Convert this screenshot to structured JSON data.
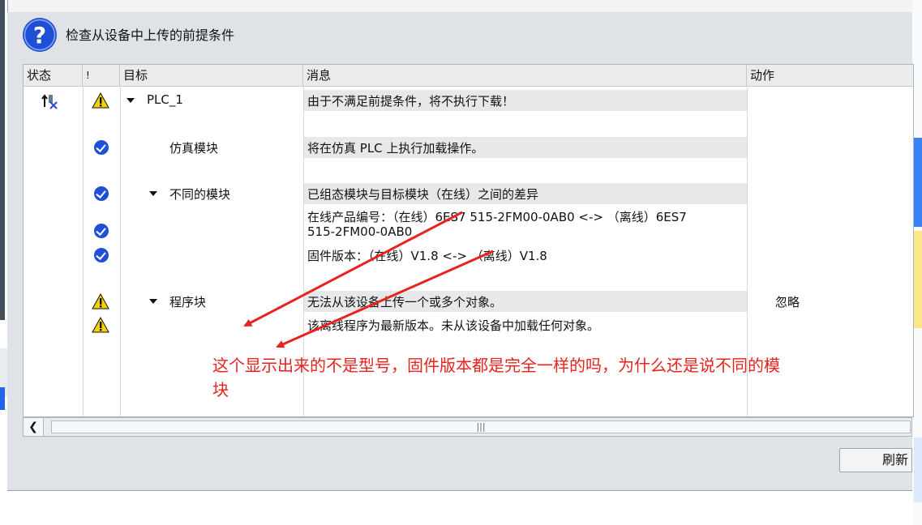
{
  "dialog": {
    "title": "检查从设备中上传的前提条件",
    "refresh_label": "刷新"
  },
  "table": {
    "headers": [
      "状态",
      "!",
      "目标",
      "消息",
      "动作"
    ],
    "rows": [
      {
        "status_icon": "upload-error-icon",
        "flag": "warning",
        "target": "PLC_1",
        "expanded": true,
        "message": "由于不满足前提条件，将不执行下载！",
        "action": ""
      },
      {
        "flag": "ok",
        "target": "仿真模块",
        "message": "将在仿真 PLC 上执行加载操作。",
        "action": ""
      },
      {
        "flag": "ok",
        "target": "不同的模块",
        "expanded": true,
        "message": "已组态模块与目标模块（在线）之间的差异",
        "action": ""
      },
      {
        "flag": "ok",
        "target": "",
        "message_line1": "在线产品编号：（在线）6ES7 515-2FM00-0AB0 <-> （离线）6ES7",
        "message_line2": "515-2FM00-0AB0",
        "action": ""
      },
      {
        "flag": "ok",
        "target": "",
        "message": "固件版本：（在线）V1.8 <-> （离线）V1.8",
        "action": ""
      },
      {
        "flag": "warning",
        "target": "程序块",
        "expanded": true,
        "message": "无法从该设备上传一个或多个对象。",
        "action": "忽略"
      },
      {
        "flag": "warning",
        "target": "",
        "message": "该离线程序为最新版本。未从该设备中加载任何对象。",
        "action": ""
      }
    ]
  },
  "scrollbar": {
    "thumb_grip": "|||"
  },
  "annotation": {
    "line1": "这个显示出来的不是型号，固件版本都是完全一样的吗，为什么还是说不同的模",
    "line2": "块",
    "color": "#e8231e"
  },
  "colors": {
    "check": "#1f4fd6",
    "warning": "#f7d000",
    "question": "#1f4fd6"
  }
}
